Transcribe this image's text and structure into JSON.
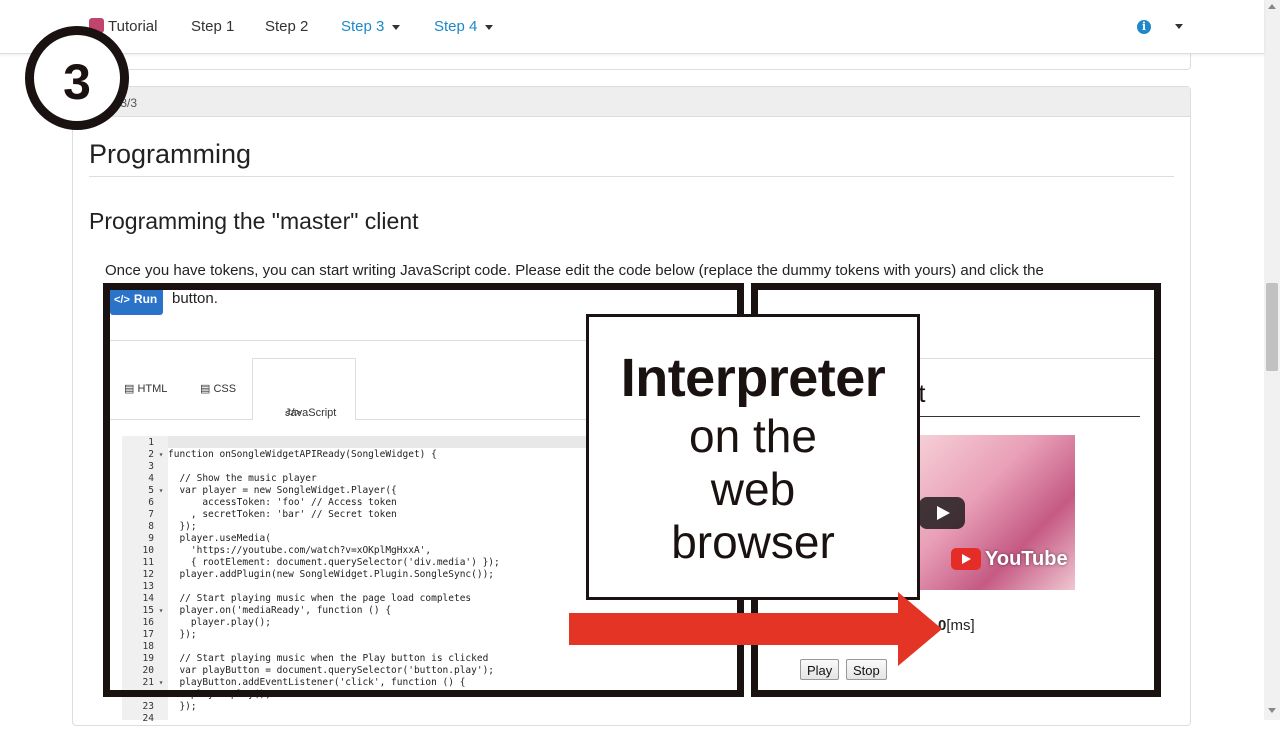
{
  "navbar": {
    "brand": "Tutorial",
    "items": [
      {
        "label": "Step 1"
      },
      {
        "label": "Step 2"
      },
      {
        "label": "Step 3"
      },
      {
        "label": "Step 4"
      }
    ],
    "info_icon": "i"
  },
  "badge": {
    "number": "3"
  },
  "card": {
    "header": "3: 3/3",
    "title": "Programming",
    "subtitle": "Programming the \"master\" client",
    "paragraph": "Once you have tokens, you can start writing JavaScript code. Please edit the code below (replace the dummy tokens with yours) and click the",
    "paragraph_cont": "button."
  },
  "run_button": {
    "label": "Run",
    "icon": "code-icon"
  },
  "tabs": [
    {
      "label": "HTML",
      "icon": "html5-icon"
    },
    {
      "label": "CSS",
      "icon": "css3-icon"
    },
    {
      "label": "JavaScript",
      "icon": "code-icon"
    }
  ],
  "code_lines": [
    {
      "n": "1",
      "fold": "",
      "text": ""
    },
    {
      "n": "2",
      "fold": "▾",
      "text": "function onSongleWidgetAPIReady(SongleWidget) {"
    },
    {
      "n": "3",
      "fold": "",
      "text": ""
    },
    {
      "n": "4",
      "fold": "",
      "text": "  // Show the music player"
    },
    {
      "n": "5",
      "fold": "▾",
      "text": "  var player = new SongleWidget.Player({"
    },
    {
      "n": "6",
      "fold": "",
      "text": "      accessToken: 'foo' // Access token"
    },
    {
      "n": "7",
      "fold": "",
      "text": "    , secretToken: 'bar' // Secret token"
    },
    {
      "n": "8",
      "fold": "",
      "text": "  });"
    },
    {
      "n": "9",
      "fold": "",
      "text": "  player.useMedia("
    },
    {
      "n": "10",
      "fold": "",
      "text": "    'https://youtube.com/watch?v=xOKplMgHxxA',"
    },
    {
      "n": "11",
      "fold": "",
      "text": "    { rootElement: document.querySelector('div.media') });"
    },
    {
      "n": "12",
      "fold": "",
      "text": "  player.addPlugin(new SongleWidget.Plugin.SongleSync());"
    },
    {
      "n": "13",
      "fold": "",
      "text": ""
    },
    {
      "n": "14",
      "fold": "",
      "text": "  // Start playing music when the page load completes"
    },
    {
      "n": "15",
      "fold": "▾",
      "text": "  player.on('mediaReady', function () {"
    },
    {
      "n": "16",
      "fold": "",
      "text": "    player.play();"
    },
    {
      "n": "17",
      "fold": "",
      "text": "  });"
    },
    {
      "n": "18",
      "fold": "",
      "text": ""
    },
    {
      "n": "19",
      "fold": "",
      "text": "  // Start playing music when the Play button is clicked"
    },
    {
      "n": "20",
      "fold": "",
      "text": "  var playButton = document.querySelector('button.play');"
    },
    {
      "n": "21",
      "fold": "▾",
      "text": "  playButton.addEventListener('click', function () {"
    },
    {
      "n": "22",
      "fold": "",
      "text": "    player.play();"
    },
    {
      "n": "23",
      "fold": "",
      "text": "  });"
    },
    {
      "n": "24",
      "fold": "",
      "text": ""
    }
  ],
  "result": {
    "heading": "st",
    "video_brand": "YouTube",
    "ms_value": "0",
    "ms_unit": "[ms]",
    "play_label": "Play",
    "stop_label": "Stop"
  },
  "callout": {
    "line1": "Interpreter",
    "line2": "on the",
    "line3": "web",
    "line4": "browser"
  },
  "colors": {
    "accent": "#1e88c8",
    "run_button": "#2b73c9",
    "arrow": "#e33425",
    "frame": "#1a1210"
  }
}
